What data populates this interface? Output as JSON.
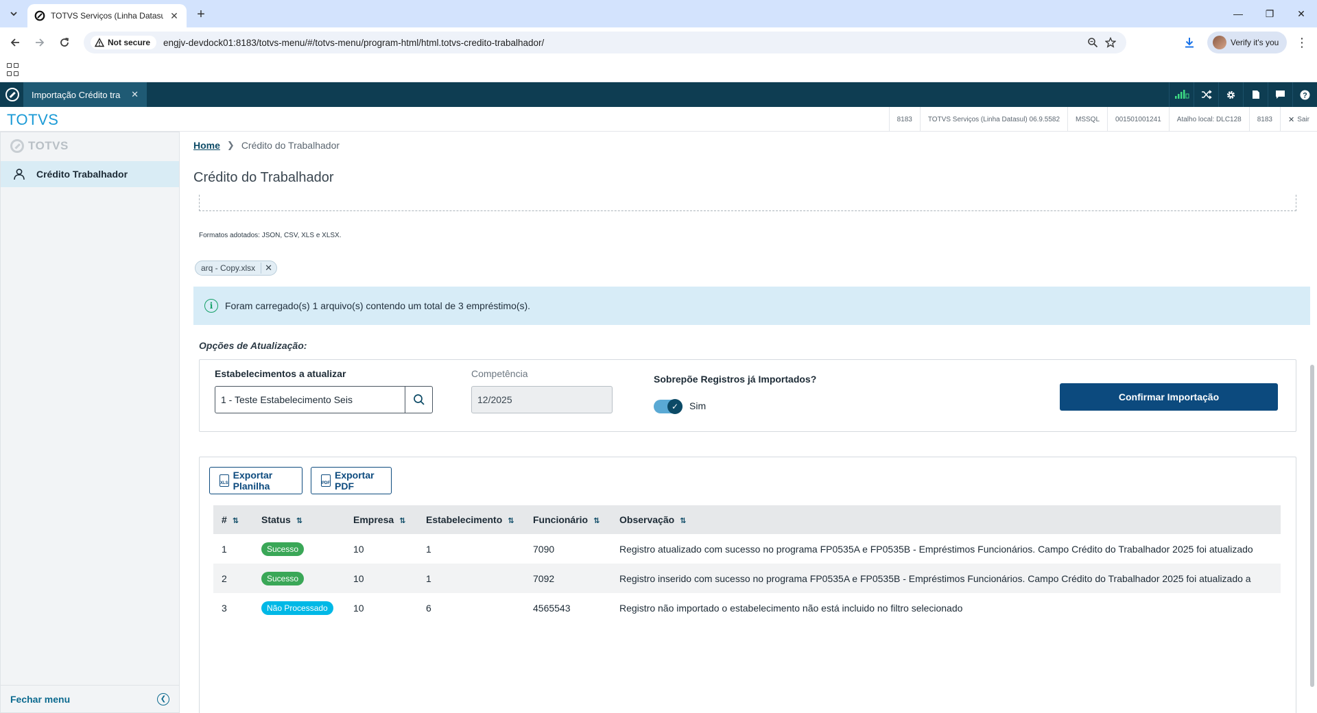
{
  "browser": {
    "tab_title": "TOTVS Serviços (Linha Datasul)",
    "security_label": "Not secure",
    "url": "engjv-devdock01:8183/totvs-menu/#/totvs-menu/program-html/html.totvs-credito-trabalhador/",
    "profile_label": "Verify it's you"
  },
  "app": {
    "tab_title": "Importação Crédito tra",
    "brand": "TOTVS",
    "status": [
      "8183",
      "TOTVS Serviços (Linha Datasul) 06.9.5582",
      "MSSQL",
      "001501001241",
      "Atalho local: DLC128",
      "8183",
      "Sair"
    ]
  },
  "sidebar": {
    "brand": "TOTVS",
    "item_label": "Crédito Trabalhador",
    "footer_label": "Fechar menu"
  },
  "main": {
    "breadcrumb": {
      "home": "Home",
      "current": "Crédito do Trabalhador"
    },
    "title": "Crédito do Trabalhador",
    "formats_text": "Formatos adotados: JSON, CSV, XLS e XLSX.",
    "file_chip": "arq - Copy.xlsx",
    "info_text": "Foram carregado(s) 1 arquivo(s) contendo um total de 3 empréstimo(s).",
    "options_title": "Opções de Atualização:",
    "estab_label": "Estabelecimentos a atualizar",
    "estab_value": "1 - Teste Estabelecimento Seis",
    "competencia_label": "Competência",
    "competencia_value": "12/2025",
    "overwrite_label": "Sobrepõe Registros já Importados?",
    "overwrite_value": "Sim",
    "confirm_button": "Confirmar Importação",
    "export_sheet": "Exportar Planilha",
    "export_pdf": "Exportar PDF"
  },
  "table": {
    "headers": [
      "#",
      "Status",
      "Empresa",
      "Estabelecimento",
      "Funcionário",
      "Observação"
    ],
    "rows": [
      {
        "num": "1",
        "status": "Sucesso",
        "empresa": "10",
        "estab": "1",
        "func": "7090",
        "obs": "Registro atualizado com sucesso no programa FP0535A e FP0535B - Empréstimos Funcionários. Campo Crédito do Trabalhador 2025 foi atualizado"
      },
      {
        "num": "2",
        "status": "Sucesso",
        "empresa": "10",
        "estab": "1",
        "func": "7092",
        "obs": "Registro inserido com sucesso no programa FP0535A e FP0535B - Empréstimos Funcionários. Campo Crédito do Trabalhador 2025 foi atualizado a"
      },
      {
        "num": "3",
        "status": "Não Processado",
        "empresa": "10",
        "estab": "6",
        "func": "4565543",
        "obs": "Registro não importado o estabelecimento não está incluido no filtro selecionado"
      }
    ]
  },
  "colors": {
    "success": "#3aa757",
    "not_processed": "#00b8e6",
    "primary": "#0c4a7e",
    "appbar": "#0e3d52"
  }
}
